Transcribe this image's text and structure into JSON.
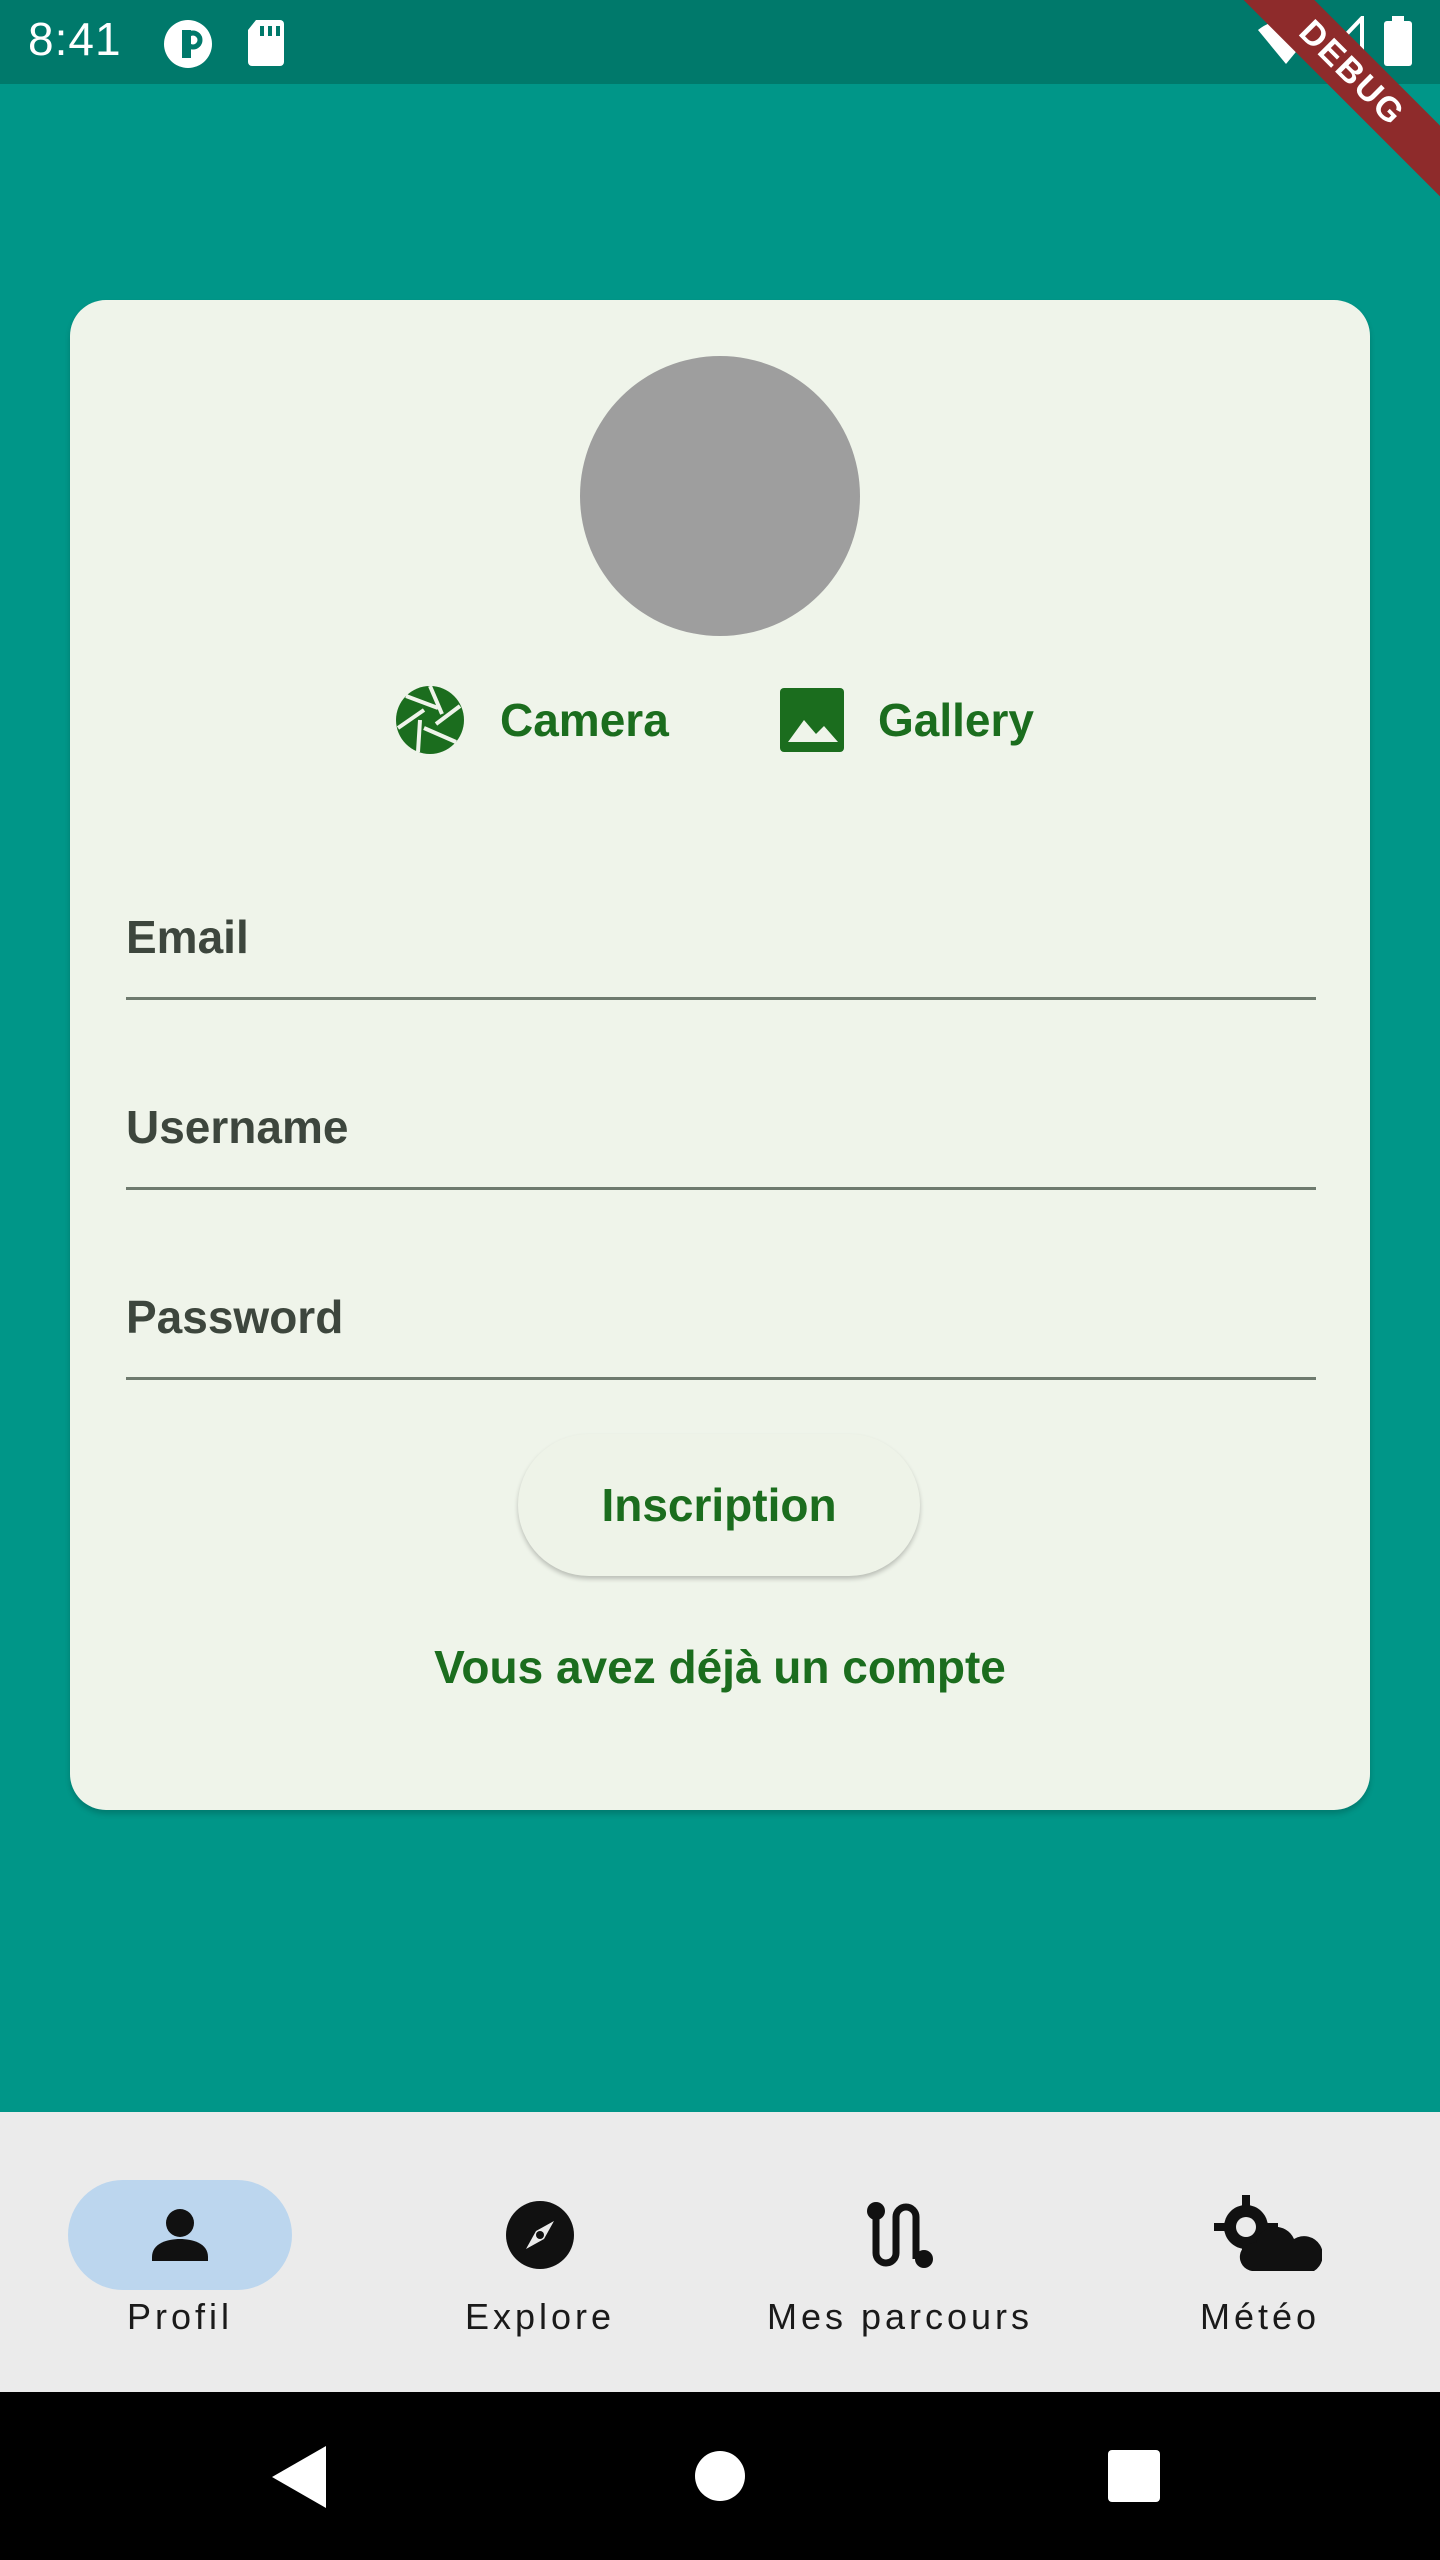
{
  "status_bar": {
    "time": "8:41"
  },
  "debug_banner": "DEBUG",
  "card": {
    "camera_label": "Camera",
    "gallery_label": "Gallery",
    "fields": [
      {
        "label": "Email"
      },
      {
        "label": "Username"
      },
      {
        "label": "Password"
      }
    ],
    "signup_button": "Inscription",
    "login_link": "Vous avez déjà un compte"
  },
  "bottom_nav": {
    "items": [
      {
        "label": "Profil",
        "icon": "person-icon",
        "active": true
      },
      {
        "label": "Explore",
        "icon": "compass-icon",
        "active": false
      },
      {
        "label": "Mes parcours",
        "icon": "route-icon",
        "active": false
      },
      {
        "label": "Météo",
        "icon": "weather-icon",
        "active": false
      }
    ]
  },
  "colors": {
    "background": "#009688",
    "status_bar": "#00796b",
    "card": "#eff4ea",
    "accent": "#1b6d1e",
    "nav_active_pill": "#bcd6ee"
  }
}
